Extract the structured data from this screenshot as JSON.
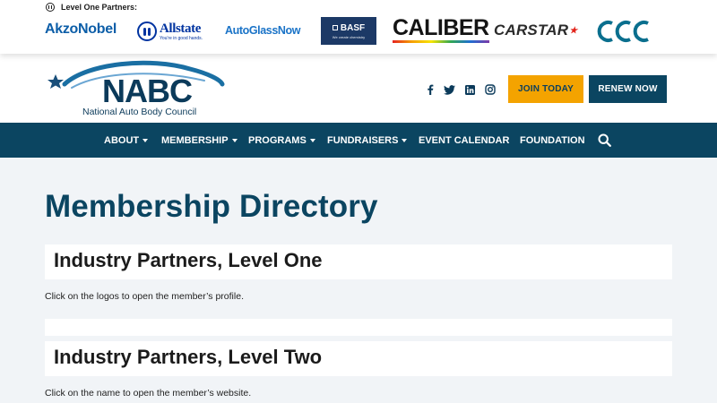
{
  "partners_bar": {
    "label": "Level One Partners:",
    "logos": {
      "akzonobel": "AkzoNobel",
      "allstate": "Allstate",
      "allstate_tagline": "You're in good hands.",
      "autoglassnow": "AutoGlassNow",
      "basf": "BASF",
      "basf_tagline": "We create chemistry",
      "caliber": "CALIBER",
      "carstar": "CARSTAR",
      "ccc": "CCC"
    }
  },
  "header": {
    "logo": {
      "name": "NABC",
      "subtitle": "National Auto Body Council"
    },
    "social": [
      "facebook-icon",
      "twitter-icon",
      "linkedin-icon",
      "instagram-icon"
    ],
    "join_label": "Join Today",
    "renew_label": "Renew Now"
  },
  "nav": {
    "items": [
      {
        "label": "About",
        "dropdown": true
      },
      {
        "label": "Membership",
        "dropdown": true
      },
      {
        "label": "Programs",
        "dropdown": true
      },
      {
        "label": "Fundraisers",
        "dropdown": true
      },
      {
        "label": "Event Calendar",
        "dropdown": false
      },
      {
        "label": "Foundation",
        "dropdown": false
      }
    ],
    "search_icon": "search-icon"
  },
  "main": {
    "title": "Membership Directory",
    "sections": [
      {
        "title": "Industry Partners, Level One",
        "note": "Click on the logos to open the member’s profile."
      },
      {
        "title": "Industry Partners, Level Two",
        "note": "Click on the name to open the member’s website."
      }
    ]
  },
  "colors": {
    "brand_navy": "#0b4561",
    "accent_orange": "#f4a300",
    "page_background": "#f1f4f7"
  }
}
